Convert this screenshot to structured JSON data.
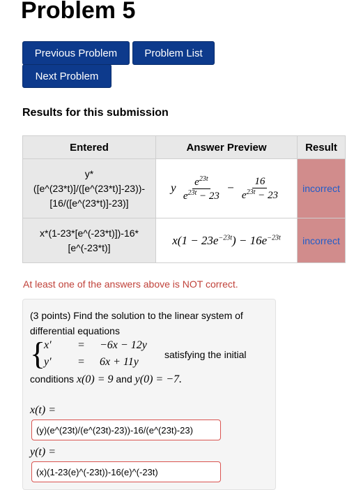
{
  "page": {
    "title": "Problem 5"
  },
  "nav": {
    "previous_label": "Previous Problem",
    "list_label": "Problem List",
    "next_label": "Next Problem"
  },
  "results": {
    "heading": "Results for this submission",
    "columns": [
      "Entered",
      "Answer Preview",
      "Result"
    ],
    "rows": [
      {
        "entered_lines": [
          "y*",
          "([e^(23*t)]/([e^(23*t)]-23))-",
          "[16/([e^(23*t)]-23)]"
        ],
        "preview": {
          "prefix": "y",
          "num1": "e",
          "num1_exp": "23t",
          "den1": "e",
          "den1_exp": "23t",
          "den1_tail": " − 23",
          "minus": "−",
          "num2": "16",
          "den2": "e",
          "den2_exp": "23t",
          "den2_tail": " − 23"
        },
        "result": "incorrect"
      },
      {
        "entered_lines": [
          "x*(1-23*[e^(-23*t)])-16*",
          "[e^(-23*t)]"
        ],
        "preview": {
          "a": "x(1 − 23e",
          "a_exp": "−23t",
          "b": ") − 16e",
          "b_exp": "−23t"
        },
        "result": "incorrect"
      }
    ],
    "warning": "At least one of the answers above is NOT correct."
  },
  "problem": {
    "statement": "(3 points) Find the solution to the linear system of differential equations",
    "eq1_lhs": "x′",
    "eq1_eq": "=",
    "eq1_rhs": "−6x − 12y",
    "eq2_lhs": "y′",
    "eq2_eq": "=",
    "eq2_rhs": "6x + 11y",
    "satisfying": "satisfying the initial",
    "conditions_text": "conditions",
    "cond_x": "x(0) = 9",
    "and": "and",
    "cond_y": "y(0) = −7."
  },
  "answers": {
    "x_label": "x(t) =",
    "x_value": "(y)(e^(23t)/(e^(23t)-23))-16/(e^(23t)-23)",
    "y_label": "y(t) =",
    "y_value": "(x)(1-23(e)^(-23t))-16(e)^(-23t)"
  },
  "colors": {
    "button": "#0d3a8c",
    "incorrect_bg": "#d18c8c",
    "incorrect_text": "#1f5cc9",
    "warning": "#c0423a",
    "field_border": "#d9534f"
  }
}
